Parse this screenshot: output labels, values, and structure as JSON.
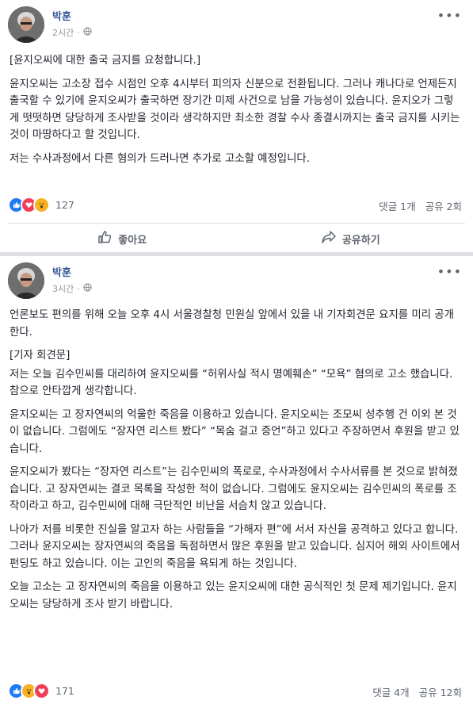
{
  "post1": {
    "author": "박훈",
    "time": "2시간",
    "privacy_icon": "globe-icon",
    "paragraphs": [
      "[윤지오씨에 대한 출국 금지를 요청합니다.]",
      "윤지오씨는 고소장 접수 시점인 오후 4시부터 피의자 신분으로 전환됩니다. 그러나 캐나다로 언제든지 출국할 수 있기에 윤지오씨가 출국하면 장기간 미제 사건으로 남을 가능성이 있습니다. 윤지오가 그렇게 떳떳하면 당당하게 조사받을 것이라 생각하지만 최소한 경찰 수사 종결시까지는 출국 금지를 시키는 것이 마땅하다고 할 것입니다.",
      "저는 수사과정에서 다른 혐의가 드러나면 추가로 고소할 예정입니다."
    ],
    "reaction_count": "127",
    "comments": "댓글 1개",
    "shares": "공유 2회",
    "like_label": "좋아요",
    "share_label": "공유하기"
  },
  "post2": {
    "author": "박훈",
    "time": "3시간",
    "privacy_icon": "globe-icon",
    "paragraphs": [
      "언론보도 편의를 위해 오늘 오후 4시 서울경찰청 민원실 앞에서 있을 내 기자회견문 요지를 미리 공개한다.",
      "[기자 회견문]",
      "저는 오늘 김수민씨를 대리하여 윤지오씨를 “허위사실 적시 명예훼손” “모욕” 혐의로 고소 했습니다. 참으로 안타깝게 생각합니다.",
      "윤지오씨는 고 장자연씨의 억울한 죽음을 이용하고 있습니다. 윤지오씨는 조모씨 성추행 건 이외 본 것이 없습니다. 그럼에도 “장자연 리스트 봤다” “목숨 걸고 증언”하고 있다고 주장하면서 후원을 받고 있습니다.",
      "윤지오씨가 봤다는 “장자연 리스트”는 김수민씨의 폭로로, 수사과정에서 수사서류를 본 것으로 밝혀졌습니다. 고 장자연씨는 결코 목록을 작성한 적이 없습니다. 그럼에도 윤지오씨는 김수민씨의 폭로를 조작이라고 하고, 김수민씨에 대해 극단적인 비난을 서슴치 않고 있습니다.",
      "나아가 저를 비롯한 진실을 알고자 하는 사람들을 “가해자 편”에 서서 자신을 공격하고 있다고 합니다. 그러나 윤지오씨는 장자연씨의 죽음을 독점하면서 많은 후원을 받고 있습니다. 심지어 해외 사이트에서 펀딩도 하고 있습니다. 이는 고인의 죽음을 욕되게 하는 것입니다.",
      "오늘 고소는 고 장자연씨의 죽음을 이용하고 있는 윤지오씨에 대한 공식적인 첫 문제 제기입니다. 윤지오씨는 당당하게 조사 받기 바랍니다."
    ],
    "reaction_count": "171",
    "comments": "댓글 4개",
    "shares": "공유 12회"
  },
  "icons": {
    "menu": "more-icon",
    "like": "thumbs-up-icon",
    "share": "share-arrow-icon"
  },
  "colors": {
    "author": "#385898",
    "like_react": "#2078f4",
    "love_react": "#f33e58",
    "wow_react": "#f7b125"
  }
}
